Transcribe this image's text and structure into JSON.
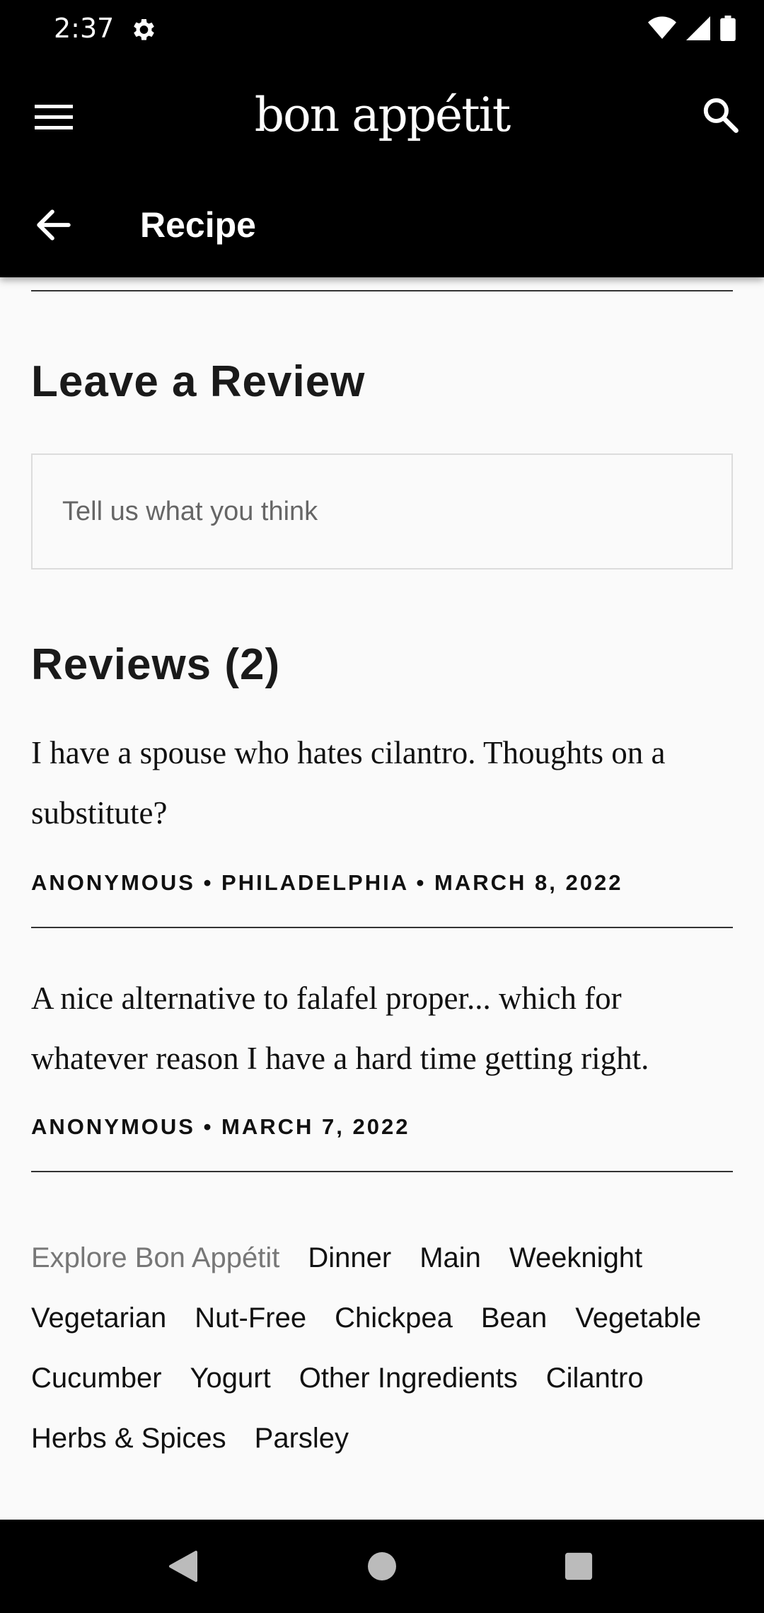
{
  "status": {
    "time": "2:37"
  },
  "app_bar": {
    "brand": "bon appétit",
    "title": "Recipe"
  },
  "leave_review": {
    "heading": "Leave a Review",
    "placeholder": "Tell us what you think"
  },
  "reviews": {
    "heading": "Reviews (2)",
    "items": [
      {
        "text": "I have a spouse who hates cilantro. Thoughts on a substitute?",
        "meta": "ANONYMOUS • PHILADELPHIA • MARCH 8, 2022"
      },
      {
        "text": "A nice alternative to falafel proper... which for whatever reason I have a hard time getting right.",
        "meta": "ANONYMOUS • MARCH 7, 2022"
      }
    ]
  },
  "explore": {
    "label": "Explore Bon Appétit",
    "tags": [
      "Dinner",
      "Main",
      "Weeknight",
      "Vegetarian",
      "Nut-Free",
      "Chickpea",
      "Bean",
      "Vegetable",
      "Cucumber",
      "Yogurt",
      "Other Ingredients",
      "Cilantro",
      "Herbs & Spices",
      "Parsley"
    ]
  },
  "icons": [
    "settings-icon",
    "wifi-icon",
    "signal-icon",
    "battery-icon",
    "menu-icon",
    "search-icon",
    "back-arrow-icon",
    "nav-back-icon",
    "nav-home-icon",
    "nav-recents-icon"
  ]
}
